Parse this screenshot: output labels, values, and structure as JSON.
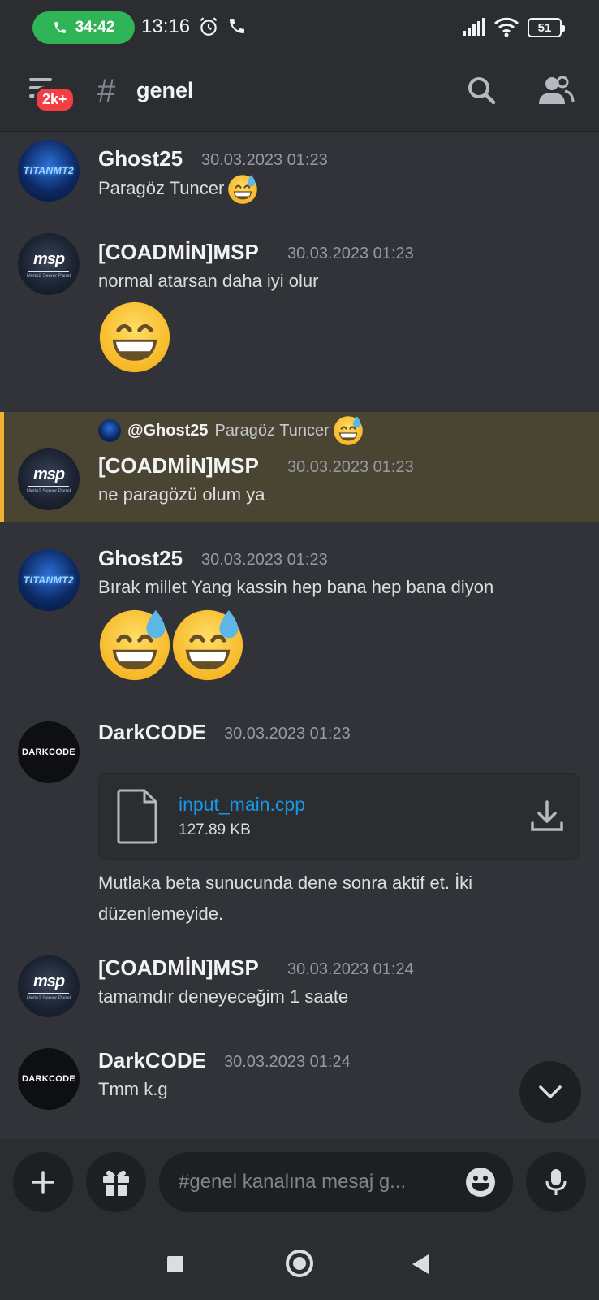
{
  "status_bar": {
    "call_timer": "34:42",
    "time": "13:16",
    "battery": "51"
  },
  "header": {
    "unread_badge": "2k+",
    "channel_prefix": "#",
    "channel_name": "genel"
  },
  "messages": [
    {
      "author": "Ghost25",
      "timestamp": "30.03.2023 01:23",
      "text": "Paragöz Tuncer",
      "avatar_label": "TITANMT2"
    },
    {
      "author": "[COADMİN]MSP",
      "timestamp": "30.03.2023 01:23",
      "text": "normal atarsan  daha iyi olur",
      "avatar_label": "msp",
      "avatar_sub": "Metin2 Server Panel"
    },
    {
      "author": "[COADMİN]MSP",
      "timestamp": "30.03.2023 01:23",
      "text": "ne paragözü olum ya",
      "reply": {
        "author": "@Ghost25",
        "text": "Paragöz Tuncer"
      }
    },
    {
      "author": "Ghost25",
      "timestamp": "30.03.2023 01:23",
      "text": "Bırak millet Yang kassin hep bana hep bana diyon"
    },
    {
      "author": "DarkCODE",
      "timestamp": "30.03.2023 01:23",
      "avatar_label": "DARKCODE",
      "attachment": {
        "file_name": "input_main.cpp",
        "file_size": "127.89 KB"
      },
      "text_line1": "Mutlaka beta sunucunda dene sonra aktif et. İki",
      "text_line2": "düzenlemeyide."
    },
    {
      "author": "[COADMİN]MSP",
      "timestamp": "30.03.2023 01:24",
      "text": "tamamdır deneyeceğim 1 saate"
    },
    {
      "author": "DarkCODE",
      "timestamp": "30.03.2023 01:24",
      "text": "Tmm k.g"
    }
  ],
  "composer": {
    "placeholder": "#genel kanalına mesaj g..."
  },
  "colors": {
    "background": "#313338",
    "header": "#2b2d31",
    "highlight": "#4a4433",
    "highlight_bar": "#f0b232",
    "link": "#1a96e6",
    "call_pill": "#2fb457",
    "badge": "#f23f43"
  },
  "icons": [
    "phone-icon",
    "alarm-icon",
    "signal-icon",
    "wifi-icon",
    "battery-icon",
    "menu-icon",
    "hash-icon",
    "search-icon",
    "members-icon",
    "grin-sweat-emoji",
    "grin-emoji",
    "file-icon",
    "download-icon",
    "chevron-down-icon",
    "plus-icon",
    "gift-icon",
    "smiley-icon",
    "mic-icon"
  ]
}
